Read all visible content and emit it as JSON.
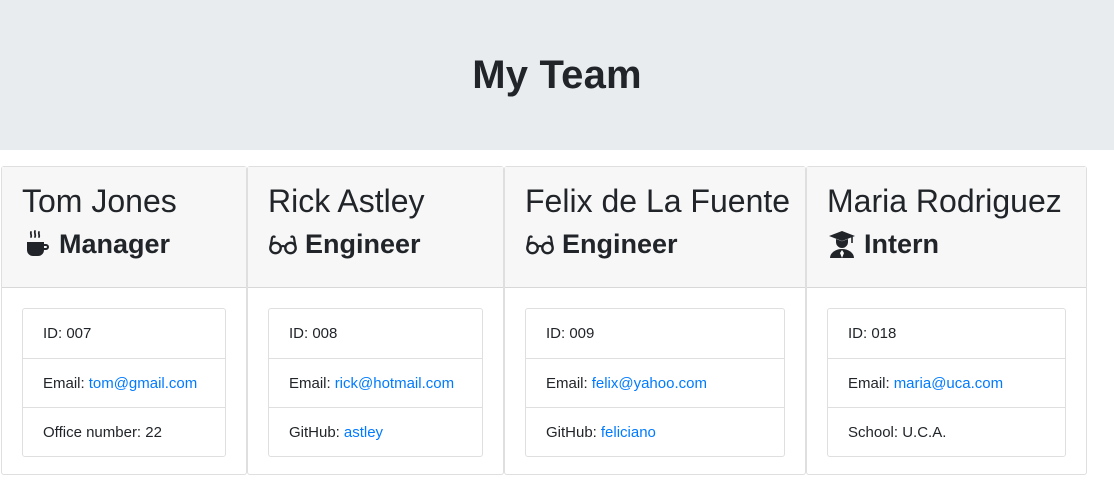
{
  "page": {
    "title": "My Team"
  },
  "team": [
    {
      "name": "Tom Jones",
      "role": "Manager",
      "icon": "coffee-mug-icon",
      "id_label": "ID: 007",
      "email_prefix": "Email:",
      "email": "tom@gmail.com",
      "extra_prefix": "Office number: 22",
      "extra_link": ""
    },
    {
      "name": "Rick Astley",
      "role": "Engineer",
      "icon": "glasses-icon",
      "id_label": "ID: 008",
      "email_prefix": "Email:",
      "email": "rick@hotmail.com",
      "extra_prefix": "GitHub:",
      "extra_link": "astley"
    },
    {
      "name": "Felix de La Fuente",
      "role": "Engineer",
      "icon": "glasses-icon",
      "id_label": "ID: 009",
      "email_prefix": "Email:",
      "email": "felix@yahoo.com",
      "extra_prefix": "GitHub:",
      "extra_link": "feliciano"
    },
    {
      "name": "Maria Rodriguez",
      "role": "Intern",
      "icon": "graduate-icon",
      "id_label": "ID: 018",
      "email_prefix": "Email:",
      "email": "maria@uca.com",
      "extra_prefix": "School: U.C.A.",
      "extra_link": ""
    }
  ],
  "colors": {
    "jumbotron_bg": "#e9ecef",
    "card_header_bg": "#f7f7f7",
    "link": "#007bff",
    "text": "#212529"
  }
}
